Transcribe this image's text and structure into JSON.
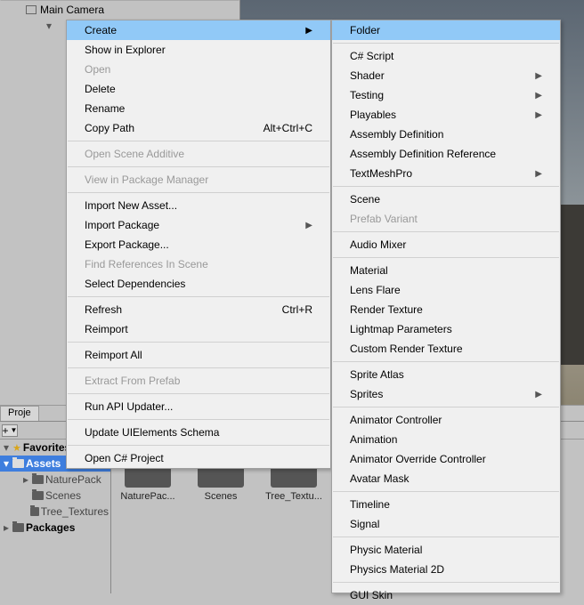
{
  "hierarchy": {
    "main_camera": "Main Camera"
  },
  "project": {
    "tab": "Proje",
    "plus": "+",
    "favorites": "Favorites",
    "assets": "Assets",
    "tree": {
      "nature_pack": "NaturePack",
      "scenes": "Scenes",
      "tree_textures": "Tree_Textures"
    },
    "packages": "Packages",
    "grid": {
      "nature_pack": "NaturePac...",
      "scenes": "Scenes",
      "tree_textures": "Tree_Textu..."
    }
  },
  "menu1": {
    "create": "Create",
    "show_in_explorer": "Show in Explorer",
    "open": "Open",
    "delete": "Delete",
    "rename": "Rename",
    "copy_path": "Copy Path",
    "copy_path_shortcut": "Alt+Ctrl+C",
    "open_scene_additive": "Open Scene Additive",
    "view_in_pm": "View in Package Manager",
    "import_new_asset": "Import New Asset...",
    "import_package": "Import Package",
    "export_package": "Export Package...",
    "find_references": "Find References In Scene",
    "select_dependencies": "Select Dependencies",
    "refresh": "Refresh",
    "refresh_shortcut": "Ctrl+R",
    "reimport": "Reimport",
    "reimport_all": "Reimport All",
    "extract_from_prefab": "Extract From Prefab",
    "run_api_updater": "Run API Updater...",
    "update_uielements": "Update UIElements Schema",
    "open_csharp": "Open C# Project"
  },
  "menu2": {
    "folder": "Folder",
    "csharp_script": "C# Script",
    "shader": "Shader",
    "testing": "Testing",
    "playables": "Playables",
    "assembly_def": "Assembly Definition",
    "assembly_def_ref": "Assembly Definition Reference",
    "textmeshpro": "TextMeshPro",
    "scene": "Scene",
    "prefab_variant": "Prefab Variant",
    "audio_mixer": "Audio Mixer",
    "material": "Material",
    "lens_flare": "Lens Flare",
    "render_texture": "Render Texture",
    "lightmap_params": "Lightmap Parameters",
    "custom_render_texture": "Custom Render Texture",
    "sprite_atlas": "Sprite Atlas",
    "sprites": "Sprites",
    "animator_controller": "Animator Controller",
    "animation": "Animation",
    "animator_override": "Animator Override Controller",
    "avatar_mask": "Avatar Mask",
    "timeline": "Timeline",
    "signal": "Signal",
    "physic_material": "Physic Material",
    "physics_material_2d": "Physics Material 2D",
    "gui_skin": "GUI Skin"
  }
}
